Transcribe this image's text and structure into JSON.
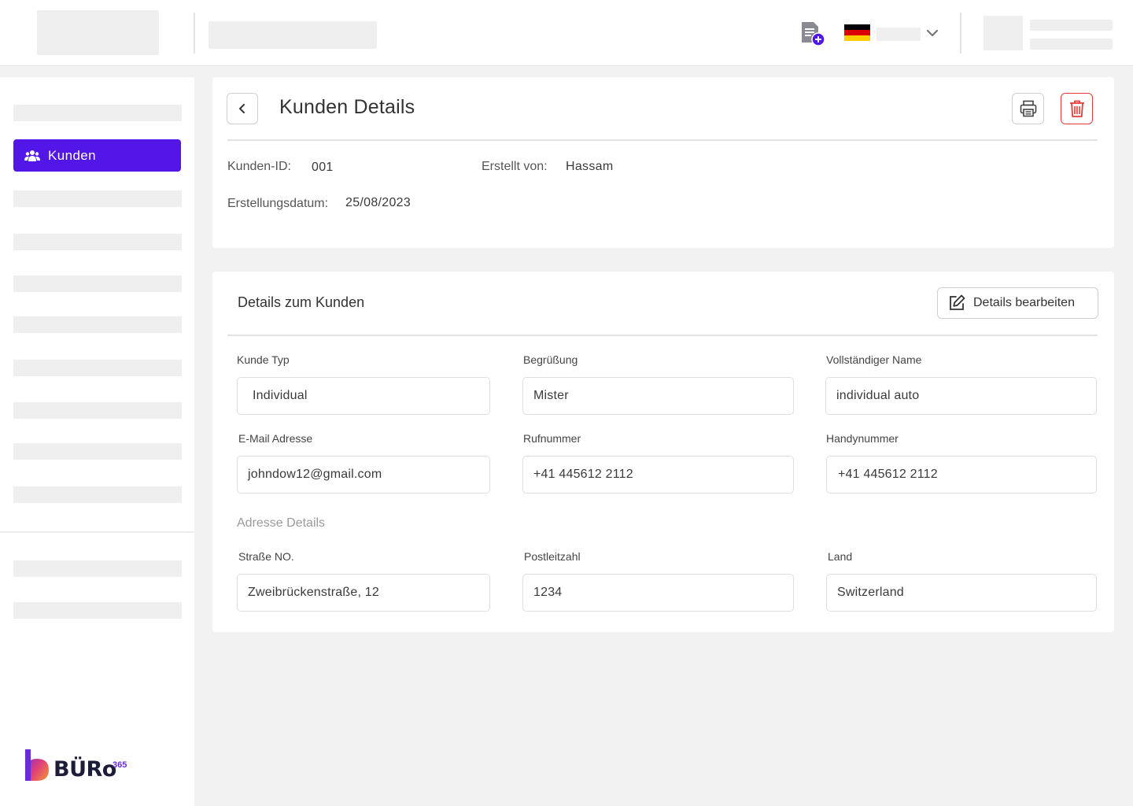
{
  "app": {
    "logo_text": "BÜRo",
    "logo_sup": "365"
  },
  "sidebar": {
    "active_item": {
      "label": "Kunden",
      "icon": "users-icon"
    }
  },
  "header": {
    "icons": [
      "note-add-icon",
      "flag-germany-icon",
      "chevron-down-icon"
    ]
  },
  "customer": {
    "page_title": "Kunden Details",
    "id_label": "Kunden-ID:",
    "id_value": "001",
    "created_by_label": "Erstellt von:",
    "created_by_value": "Hassam",
    "date_label": "Erstellungsdatum:",
    "date_value": "25/08/2023"
  },
  "details": {
    "section_title": "Details zum Kunden",
    "edit_button": "Details bearbeiten",
    "fields": {
      "kunde_typ": {
        "label": "Kunde Typ",
        "value": "Individual"
      },
      "begruessung": {
        "label": "Begrüßung",
        "value": "Mister"
      },
      "name": {
        "label": "Vollständiger Name",
        "value": "individual auto"
      },
      "email": {
        "label": "E-Mail Adresse",
        "value": "johndow12@gmail.com"
      },
      "phone": {
        "label": "Rufnummer",
        "value": "+41 445612 2112"
      },
      "mobile": {
        "label": "Handynummer",
        "value": "+41 445612 2112"
      }
    },
    "address_title": "Adresse Details",
    "address": {
      "street": {
        "label": "Straße NO.",
        "value": "Zweibrückenstraße, 12"
      },
      "zip": {
        "label": "Postleitzahl",
        "value": "1234"
      },
      "country": {
        "label": "Land",
        "value": "Switzerland"
      }
    }
  },
  "colors": {
    "accent": "#5316e8",
    "danger": "#e43c3c",
    "background": "#f2f2f2"
  }
}
